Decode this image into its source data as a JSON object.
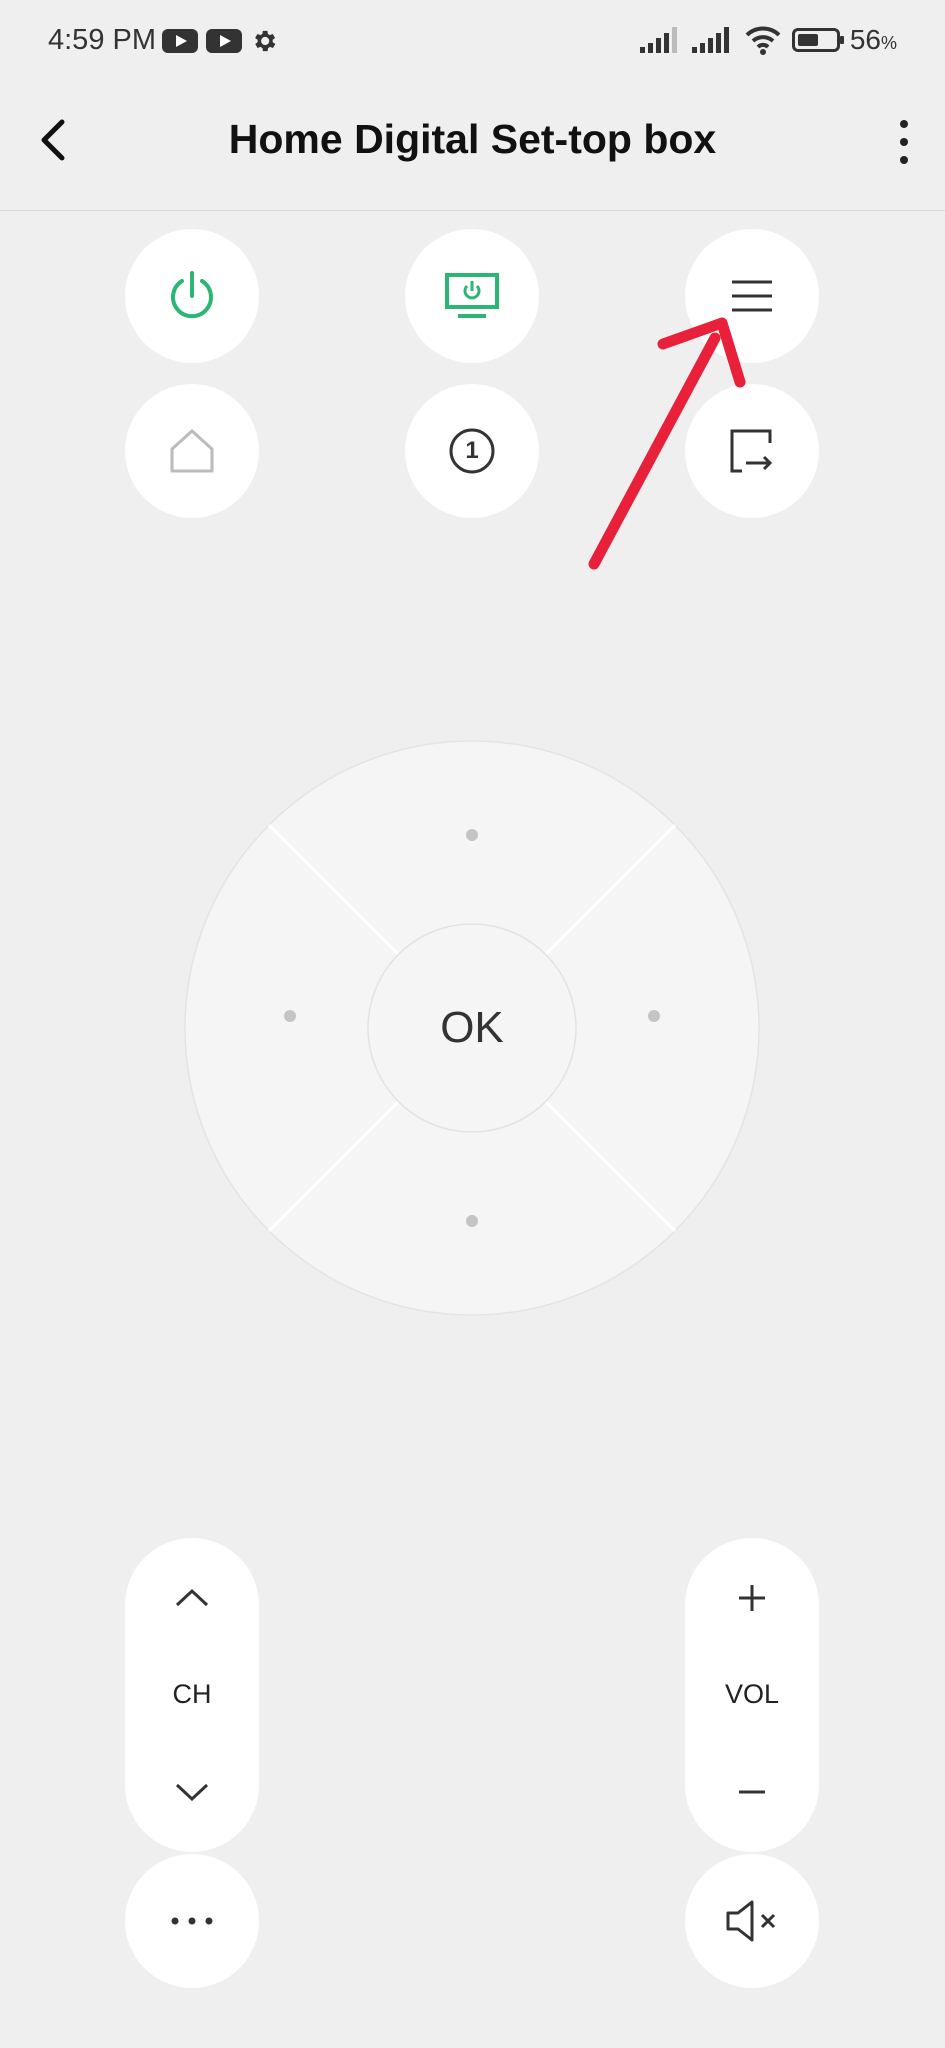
{
  "status_bar": {
    "time": "4:59 PM",
    "battery_percent": "56",
    "battery_unit": "%",
    "battery_level": 0.56,
    "icons": [
      "youtube-icon",
      "youtube-icon",
      "settings-gear-icon",
      "signal-icon",
      "signal-icon",
      "wifi-icon",
      "battery-icon"
    ]
  },
  "app_bar": {
    "title": "Home Digital Set-top box",
    "back_icon": "back-arrow-icon",
    "more_icon": "more-vert-icon"
  },
  "top_buttons": [
    {
      "name": "power-button",
      "icon": "power-icon",
      "color": "#2bb673"
    },
    {
      "name": "tv-power-button",
      "icon": "tv-power-icon",
      "color": "#2bb673"
    },
    {
      "name": "menu-button",
      "icon": "menu-icon",
      "color": "#333333"
    },
    {
      "name": "home-button",
      "icon": "home-icon",
      "color": "#bbbbbb"
    },
    {
      "name": "number-button",
      "icon": "number-one-icon",
      "color": "#333333"
    },
    {
      "name": "input-source-button",
      "icon": "input-source-icon",
      "color": "#333333"
    }
  ],
  "number_button_label": "1",
  "dpad": {
    "ok_label": "OK"
  },
  "channel": {
    "label": "CH",
    "up_icon": "chevron-up-icon",
    "down_icon": "chevron-down-icon"
  },
  "volume": {
    "label": "VOL",
    "up_icon": "plus-icon",
    "down_icon": "minus-icon"
  },
  "bottom": {
    "more_icon": "more-horiz-icon",
    "mute_icon": "mute-icon"
  },
  "annotation": {
    "arrow_color": "#e8203a"
  }
}
